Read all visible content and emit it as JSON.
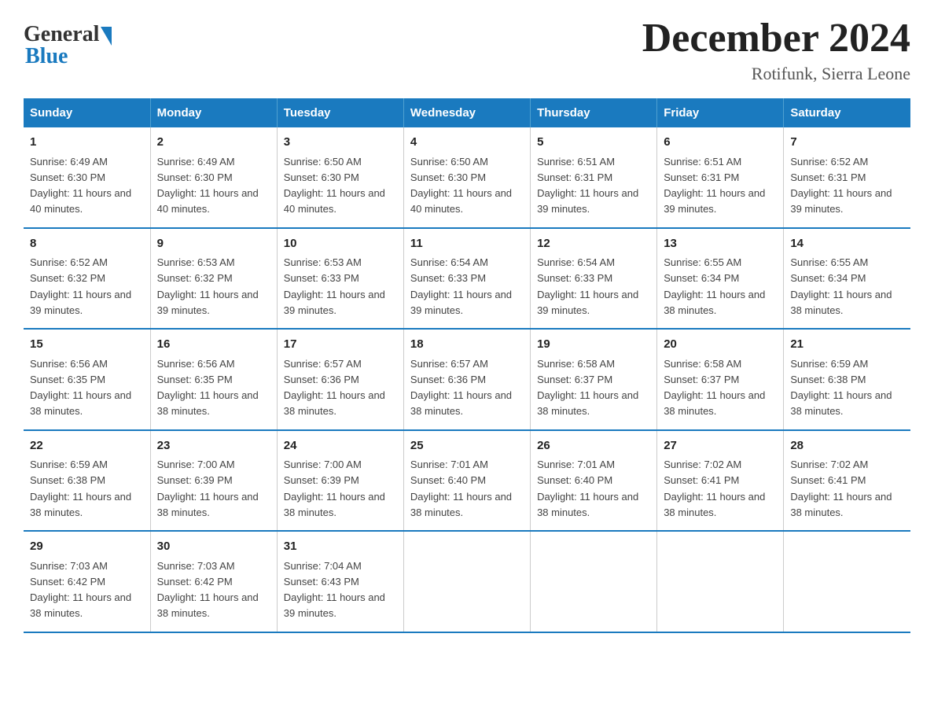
{
  "logo": {
    "general": "General",
    "blue": "Blue"
  },
  "title": "December 2024",
  "location": "Rotifunk, Sierra Leone",
  "weekdays": [
    "Sunday",
    "Monday",
    "Tuesday",
    "Wednesday",
    "Thursday",
    "Friday",
    "Saturday"
  ],
  "weeks": [
    [
      {
        "day": "1",
        "sunrise": "Sunrise: 6:49 AM",
        "sunset": "Sunset: 6:30 PM",
        "daylight": "Daylight: 11 hours and 40 minutes."
      },
      {
        "day": "2",
        "sunrise": "Sunrise: 6:49 AM",
        "sunset": "Sunset: 6:30 PM",
        "daylight": "Daylight: 11 hours and 40 minutes."
      },
      {
        "day": "3",
        "sunrise": "Sunrise: 6:50 AM",
        "sunset": "Sunset: 6:30 PM",
        "daylight": "Daylight: 11 hours and 40 minutes."
      },
      {
        "day": "4",
        "sunrise": "Sunrise: 6:50 AM",
        "sunset": "Sunset: 6:30 PM",
        "daylight": "Daylight: 11 hours and 40 minutes."
      },
      {
        "day": "5",
        "sunrise": "Sunrise: 6:51 AM",
        "sunset": "Sunset: 6:31 PM",
        "daylight": "Daylight: 11 hours and 39 minutes."
      },
      {
        "day": "6",
        "sunrise": "Sunrise: 6:51 AM",
        "sunset": "Sunset: 6:31 PM",
        "daylight": "Daylight: 11 hours and 39 minutes."
      },
      {
        "day": "7",
        "sunrise": "Sunrise: 6:52 AM",
        "sunset": "Sunset: 6:31 PM",
        "daylight": "Daylight: 11 hours and 39 minutes."
      }
    ],
    [
      {
        "day": "8",
        "sunrise": "Sunrise: 6:52 AM",
        "sunset": "Sunset: 6:32 PM",
        "daylight": "Daylight: 11 hours and 39 minutes."
      },
      {
        "day": "9",
        "sunrise": "Sunrise: 6:53 AM",
        "sunset": "Sunset: 6:32 PM",
        "daylight": "Daylight: 11 hours and 39 minutes."
      },
      {
        "day": "10",
        "sunrise": "Sunrise: 6:53 AM",
        "sunset": "Sunset: 6:33 PM",
        "daylight": "Daylight: 11 hours and 39 minutes."
      },
      {
        "day": "11",
        "sunrise": "Sunrise: 6:54 AM",
        "sunset": "Sunset: 6:33 PM",
        "daylight": "Daylight: 11 hours and 39 minutes."
      },
      {
        "day": "12",
        "sunrise": "Sunrise: 6:54 AM",
        "sunset": "Sunset: 6:33 PM",
        "daylight": "Daylight: 11 hours and 39 minutes."
      },
      {
        "day": "13",
        "sunrise": "Sunrise: 6:55 AM",
        "sunset": "Sunset: 6:34 PM",
        "daylight": "Daylight: 11 hours and 38 minutes."
      },
      {
        "day": "14",
        "sunrise": "Sunrise: 6:55 AM",
        "sunset": "Sunset: 6:34 PM",
        "daylight": "Daylight: 11 hours and 38 minutes."
      }
    ],
    [
      {
        "day": "15",
        "sunrise": "Sunrise: 6:56 AM",
        "sunset": "Sunset: 6:35 PM",
        "daylight": "Daylight: 11 hours and 38 minutes."
      },
      {
        "day": "16",
        "sunrise": "Sunrise: 6:56 AM",
        "sunset": "Sunset: 6:35 PM",
        "daylight": "Daylight: 11 hours and 38 minutes."
      },
      {
        "day": "17",
        "sunrise": "Sunrise: 6:57 AM",
        "sunset": "Sunset: 6:36 PM",
        "daylight": "Daylight: 11 hours and 38 minutes."
      },
      {
        "day": "18",
        "sunrise": "Sunrise: 6:57 AM",
        "sunset": "Sunset: 6:36 PM",
        "daylight": "Daylight: 11 hours and 38 minutes."
      },
      {
        "day": "19",
        "sunrise": "Sunrise: 6:58 AM",
        "sunset": "Sunset: 6:37 PM",
        "daylight": "Daylight: 11 hours and 38 minutes."
      },
      {
        "day": "20",
        "sunrise": "Sunrise: 6:58 AM",
        "sunset": "Sunset: 6:37 PM",
        "daylight": "Daylight: 11 hours and 38 minutes."
      },
      {
        "day": "21",
        "sunrise": "Sunrise: 6:59 AM",
        "sunset": "Sunset: 6:38 PM",
        "daylight": "Daylight: 11 hours and 38 minutes."
      }
    ],
    [
      {
        "day": "22",
        "sunrise": "Sunrise: 6:59 AM",
        "sunset": "Sunset: 6:38 PM",
        "daylight": "Daylight: 11 hours and 38 minutes."
      },
      {
        "day": "23",
        "sunrise": "Sunrise: 7:00 AM",
        "sunset": "Sunset: 6:39 PM",
        "daylight": "Daylight: 11 hours and 38 minutes."
      },
      {
        "day": "24",
        "sunrise": "Sunrise: 7:00 AM",
        "sunset": "Sunset: 6:39 PM",
        "daylight": "Daylight: 11 hours and 38 minutes."
      },
      {
        "day": "25",
        "sunrise": "Sunrise: 7:01 AM",
        "sunset": "Sunset: 6:40 PM",
        "daylight": "Daylight: 11 hours and 38 minutes."
      },
      {
        "day": "26",
        "sunrise": "Sunrise: 7:01 AM",
        "sunset": "Sunset: 6:40 PM",
        "daylight": "Daylight: 11 hours and 38 minutes."
      },
      {
        "day": "27",
        "sunrise": "Sunrise: 7:02 AM",
        "sunset": "Sunset: 6:41 PM",
        "daylight": "Daylight: 11 hours and 38 minutes."
      },
      {
        "day": "28",
        "sunrise": "Sunrise: 7:02 AM",
        "sunset": "Sunset: 6:41 PM",
        "daylight": "Daylight: 11 hours and 38 minutes."
      }
    ],
    [
      {
        "day": "29",
        "sunrise": "Sunrise: 7:03 AM",
        "sunset": "Sunset: 6:42 PM",
        "daylight": "Daylight: 11 hours and 38 minutes."
      },
      {
        "day": "30",
        "sunrise": "Sunrise: 7:03 AM",
        "sunset": "Sunset: 6:42 PM",
        "daylight": "Daylight: 11 hours and 38 minutes."
      },
      {
        "day": "31",
        "sunrise": "Sunrise: 7:04 AM",
        "sunset": "Sunset: 6:43 PM",
        "daylight": "Daylight: 11 hours and 39 minutes."
      },
      null,
      null,
      null,
      null
    ]
  ]
}
